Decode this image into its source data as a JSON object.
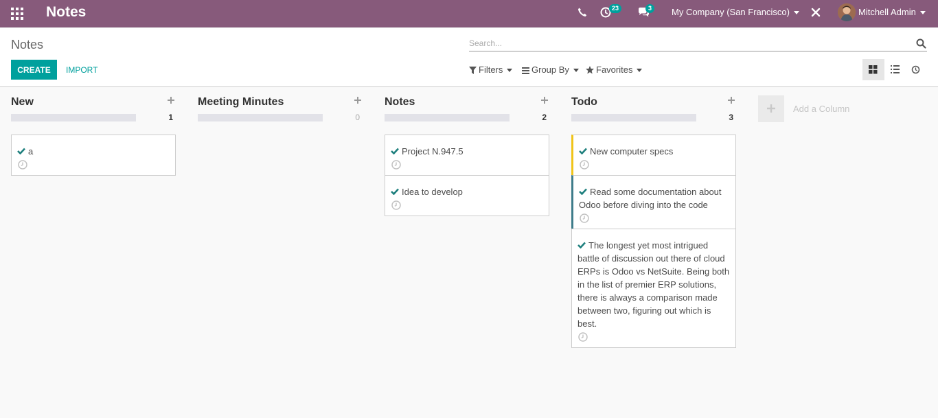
{
  "navbar": {
    "app_title": "Notes",
    "activity_count": "23",
    "message_count": "3",
    "company": "My Company (San Francisco)",
    "user": "Mitchell Admin"
  },
  "control_panel": {
    "breadcrumb": "Notes",
    "search_placeholder": "Search...",
    "create_label": "CREATE",
    "import_label": "IMPORT",
    "filters_label": "Filters",
    "groupby_label": "Group By",
    "favorites_label": "Favorites",
    "views": [
      "kanban",
      "list",
      "activity"
    ],
    "active_view": "kanban"
  },
  "kanban": {
    "columns": [
      {
        "title": "New",
        "count": "1",
        "cards": [
          {
            "text": "a",
            "bar": ""
          }
        ]
      },
      {
        "title": "Meeting Minutes",
        "count": "0",
        "cards": []
      },
      {
        "title": "Notes",
        "count": "2",
        "cards": [
          {
            "text": "Project N.947.5",
            "bar": ""
          },
          {
            "text": "Idea to develop",
            "bar": ""
          }
        ]
      },
      {
        "title": "Todo",
        "count": "3",
        "cards": [
          {
            "text": "New computer specs",
            "bar": "#f0c419"
          },
          {
            "text": "Read some documentation about Odoo before diving into the code",
            "bar": "#3e7c8a"
          },
          {
            "text": "The longest yet most intrigued battle of discussion out there of cloud ERPs is Odoo vs NetSuite. Being both in the list of premier ERP solutions, there is always a comparison made between two, figuring out which is best.",
            "bar": ""
          }
        ]
      }
    ],
    "add_column_label": "Add a Column"
  },
  "colors": {
    "navbar": "#875a7b",
    "primary": "#00a09d",
    "check": "#1d7f7d"
  }
}
